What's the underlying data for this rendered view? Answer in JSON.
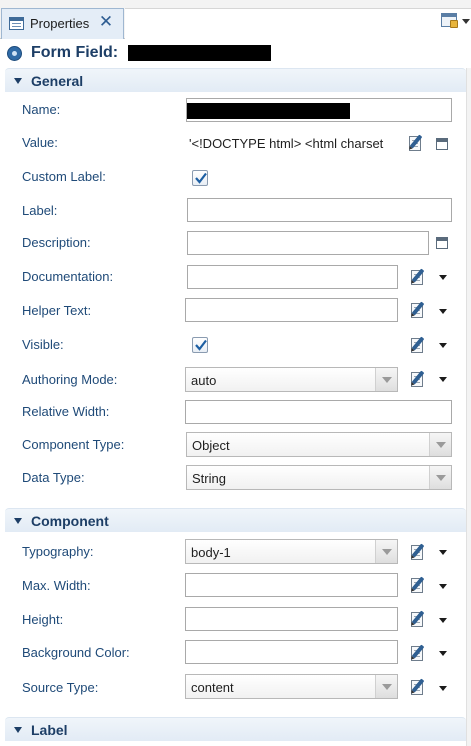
{
  "tab": {
    "label": "Properties",
    "close": "✕"
  },
  "header": {
    "title": "Form Field:"
  },
  "sections": {
    "general": "General",
    "component": "Component",
    "label": "Label"
  },
  "general": {
    "name_label": "Name:",
    "value_label": "Value:",
    "value_text": "'<!DOCTYPE html> <html charset",
    "custom_label_label": "Custom Label:",
    "custom_label_checked": true,
    "label_label": "Label:",
    "label_value": "",
    "description_label": "Description:",
    "description_value": "",
    "documentation_label": "Documentation:",
    "documentation_value": "",
    "helper_text_label": "Helper Text:",
    "helper_text_value": "",
    "visible_label": "Visible:",
    "visible_checked": true,
    "authoring_mode_label": "Authoring Mode:",
    "authoring_mode_value": "auto",
    "relative_width_label": "Relative Width:",
    "relative_width_value": "",
    "component_type_label": "Component Type:",
    "component_type_value": "Object",
    "data_type_label": "Data Type:",
    "data_type_value": "String"
  },
  "component": {
    "typography_label": "Typography:",
    "typography_value": "body-1",
    "max_width_label": "Max. Width:",
    "max_width_value": "",
    "height_label": "Height:",
    "height_value": "",
    "background_color_label": "Background Color:",
    "background_color_value": "",
    "source_type_label": "Source Type:",
    "source_type_value": "content"
  },
  "colors": {
    "label_text": "#1f4a78",
    "section_title": "#1d3e66",
    "section_bg": "#e6eef7"
  }
}
